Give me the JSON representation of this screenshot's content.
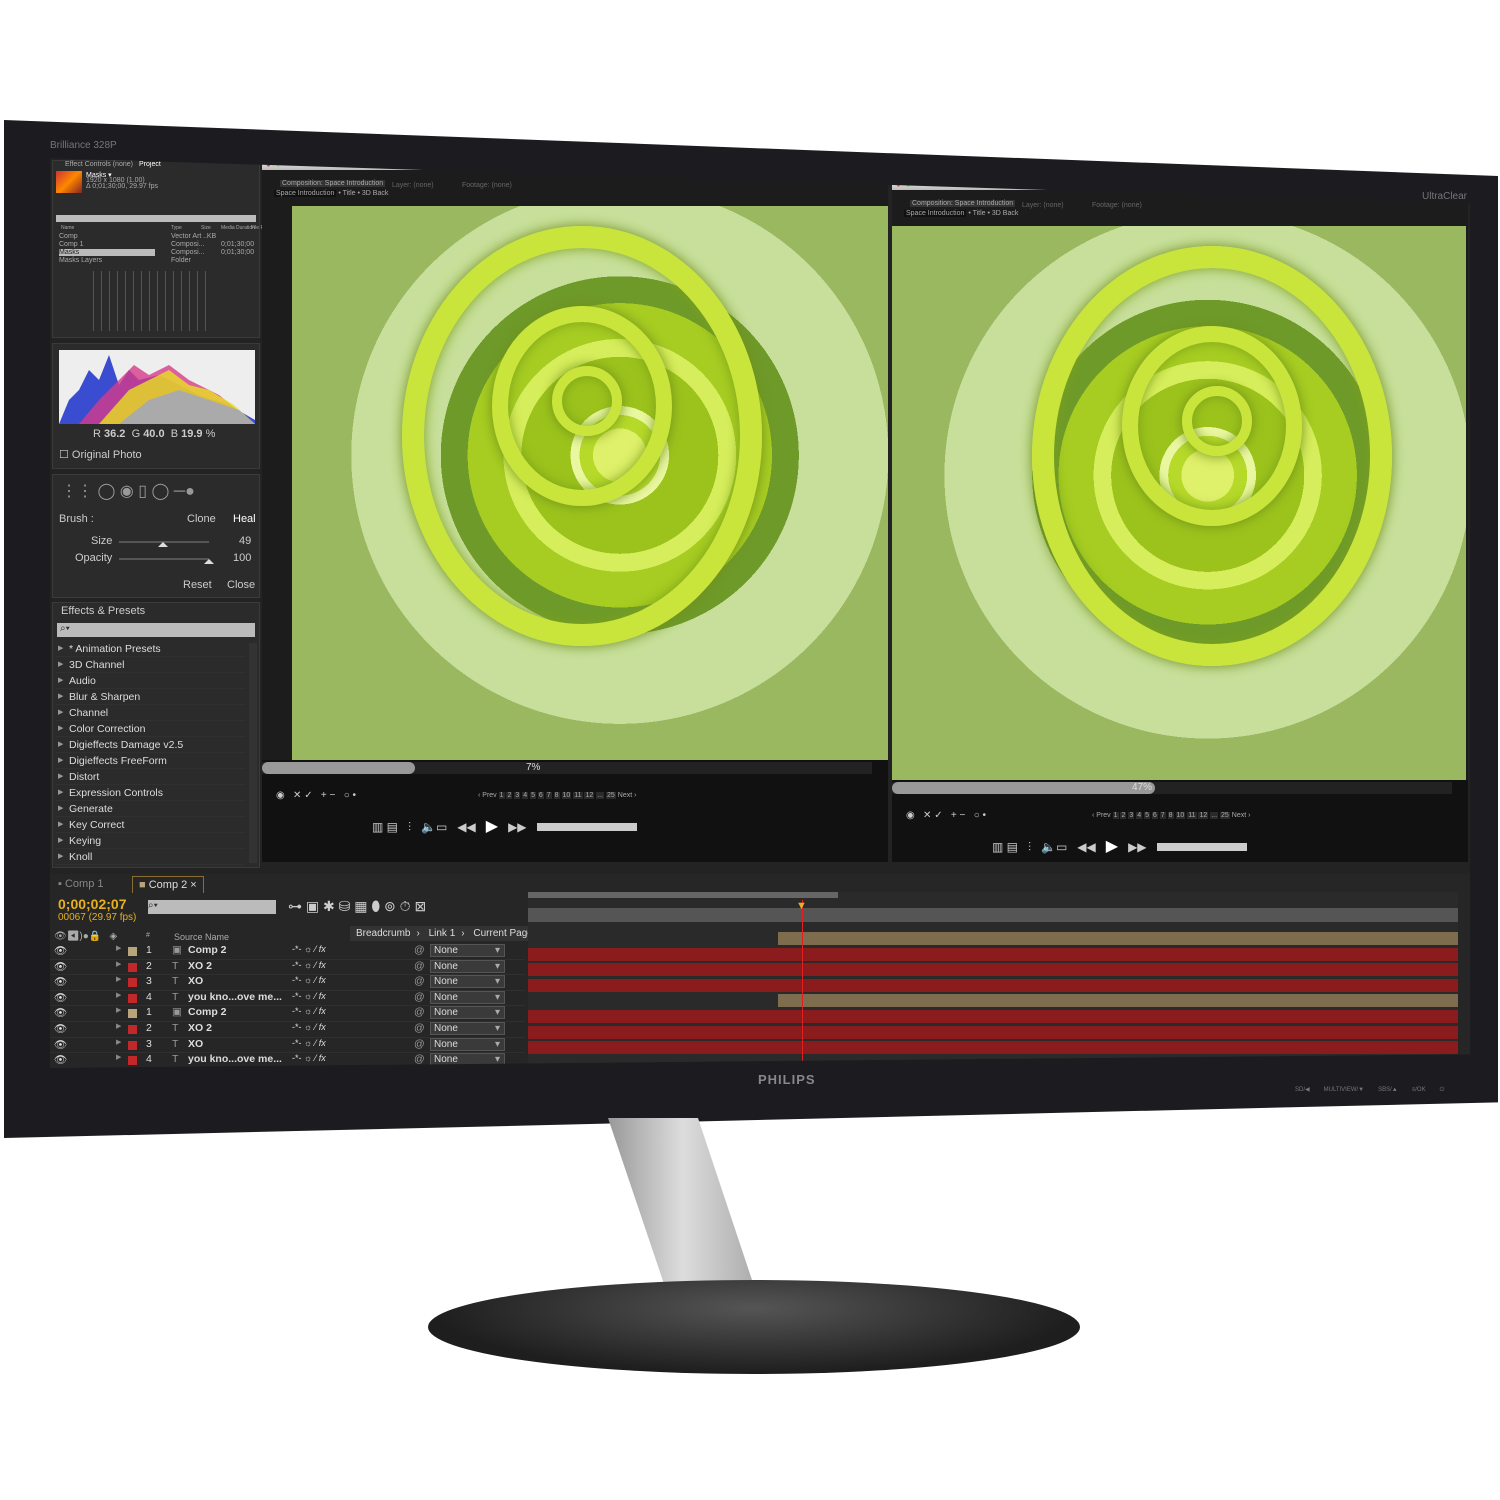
{
  "monitor": {
    "model": "Brilliance 328P",
    "tagline": "UltraClear",
    "logo": "PHILIPS",
    "buttons": [
      "SD/◀",
      "MULTIVIEW/▼",
      "SBS/▲",
      "≡/OK",
      "power-icon"
    ]
  },
  "project": {
    "tabs": [
      "Effect Controls (none)",
      "Project"
    ],
    "item": "Masks ▾",
    "resolution": "1920 x 1080 (1.00)",
    "duration": "Δ 0;01;30;00, 29.97 fps",
    "columns": [
      "Name",
      "Type",
      "Size",
      "Media Duration",
      "File Path"
    ],
    "rows": [
      {
        "name": "Comp",
        "type": "Vector Art",
        "size": "..KB",
        "dur": ""
      },
      {
        "name": "Comp 1",
        "type": "Composi...",
        "size": "",
        "dur": "0;01;30;00"
      },
      {
        "name": "Masks",
        "type": "Composi...",
        "size": "",
        "dur": "0;01;30;00"
      },
      {
        "name": "Masks Layers",
        "type": "Folder",
        "size": "",
        "dur": ""
      }
    ]
  },
  "histogram": {
    "r_label": "R",
    "r": "36.2",
    "g_label": "G",
    "g": "40.0",
    "b_label": "B",
    "b": "19.9",
    "unit": "%",
    "original_photo": "Original Photo"
  },
  "brush": {
    "label": "Brush :",
    "clone": "Clone",
    "heal": "Heal",
    "size_label": "Size",
    "size": "49",
    "opacity_label": "Opacity",
    "opacity": "100",
    "reset": "Reset",
    "close": "Close",
    "size_level": 0.49,
    "opacity_level": 1.0
  },
  "effects": {
    "tab": "Effects & Presets",
    "items": [
      "* Animation Presets",
      "3D Channel",
      "Audio",
      "Blur & Sharpen",
      "Channel",
      "Color Correction",
      "Digieffects Damage v2.5",
      "Digieffects FreeForm",
      "Distort",
      "Expression Controls",
      "Generate",
      "Key Correct",
      "Keying",
      "Knoll"
    ]
  },
  "viewers": [
    {
      "comp_tab": "Composition: Space Introduction",
      "layer_tab": "Layer: (none)",
      "footage_tab": "Footage: (none)",
      "crumbs": [
        "Space Introduction",
        "Title",
        "3D Back"
      ],
      "progress_label": "7%",
      "progress": 0.07,
      "pager": {
        "prev": "‹ Prev",
        "pages": [
          "1",
          "2",
          "3",
          "4",
          "5",
          "6",
          "7",
          "8",
          "10",
          "11",
          "12",
          "...",
          "25"
        ],
        "next": "Next ›"
      }
    },
    {
      "comp_tab": "Composition: Space Introduction",
      "layer_tab": "Layer: (none)",
      "footage_tab": "Footage: (none)",
      "crumbs": [
        "Space Introduction",
        "Title",
        "3D Back"
      ],
      "progress_label": "47%",
      "progress": 0.47,
      "pager": {
        "prev": "‹ Prev",
        "pages": [
          "1",
          "2",
          "3",
          "4",
          "5",
          "6",
          "7",
          "8",
          "10",
          "11",
          "12",
          "...",
          "25"
        ],
        "next": "Next ›"
      }
    }
  ],
  "timeline": {
    "tabs": [
      "Comp 1",
      "Comp 2"
    ],
    "timecode": "0;00;02;07",
    "frames": "00067 (29.97 fps)",
    "source_header": "Source Name",
    "num_header": "#",
    "breadcrumb": [
      "Breadcrumb",
      "Link 1",
      "Current Page"
    ],
    "layers": [
      {
        "n": "1",
        "name": "Comp 2",
        "color": "#b8a57a",
        "type": "comp",
        "parent": "None"
      },
      {
        "n": "2",
        "name": "XO 2",
        "color": "#c0282a",
        "type": "text",
        "parent": "None"
      },
      {
        "n": "3",
        "name": "XO",
        "color": "#c0282a",
        "type": "text",
        "parent": "None"
      },
      {
        "n": "4",
        "name": "you kno...ove me...",
        "color": "#c0282a",
        "type": "text",
        "parent": "None"
      },
      {
        "n": "1",
        "name": "Comp 2",
        "color": "#b8a57a",
        "type": "comp",
        "parent": "None"
      },
      {
        "n": "2",
        "name": "XO 2",
        "color": "#c0282a",
        "type": "text",
        "parent": "None"
      },
      {
        "n": "3",
        "name": "XO",
        "color": "#c0282a",
        "type": "text",
        "parent": "None"
      },
      {
        "n": "4",
        "name": "you kno...ove me...",
        "color": "#c0282a",
        "type": "text",
        "parent": "None"
      }
    ]
  },
  "colors": {
    "timecode": "#e8b020",
    "layer_bar_red": "#8a1c1e",
    "layer_bar_tan": "#7d6d4e",
    "photo_green": "#b6d92a"
  }
}
